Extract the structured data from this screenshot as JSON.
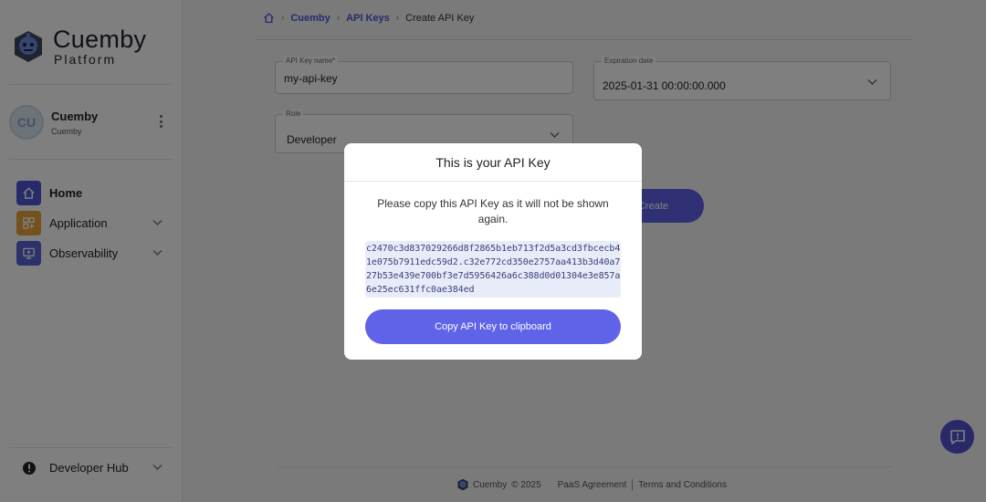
{
  "brand": {
    "name": "Cuemby",
    "subtitle": "Platform"
  },
  "user": {
    "initials": "CU",
    "name": "Cuemby",
    "org": "Cuemby"
  },
  "nav": {
    "items": [
      {
        "label": "Home",
        "icon": "home-icon",
        "color": "#4f57d6"
      },
      {
        "label": "Application",
        "icon": "apps-icon",
        "color": "#e8a23a"
      },
      {
        "label": "Observability",
        "icon": "monitor-icon",
        "color": "#5b63d8"
      }
    ],
    "developer_hub": "Developer Hub"
  },
  "breadcrumb": {
    "root": "Cuemby",
    "section": "API Keys",
    "current": "Create API Key"
  },
  "form": {
    "name_label": "API Key name*",
    "name_value": "my-api-key",
    "expiration_label": "Expiration date",
    "expiration_value": "2025-01-31 00:00:00.000",
    "role_label": "Role",
    "role_value": "Developer",
    "create_label": "Create"
  },
  "modal": {
    "title": "This is your API Key",
    "message": "Please copy this API Key as it will not be shown again.",
    "api_key": "c2470c3d837029266d8f2865b1eb713f2d5a3cd3fbcecb41e075b7911edc59d2.c32e772cd350e2757aa413b3d40a727b53e439e700bf3e7d5956426a6c388d0d01304e3e857a6e25ec631ffc0ae384ed",
    "copy_label": "Copy API Key to clipboard"
  },
  "footer": {
    "brand": "Cuemby",
    "copyright": "© 2025",
    "paas": "PaaS Agreement",
    "terms": "Terms and Conditions"
  },
  "colors": {
    "accent": "#5f63e8",
    "fab": "#5352d2"
  }
}
